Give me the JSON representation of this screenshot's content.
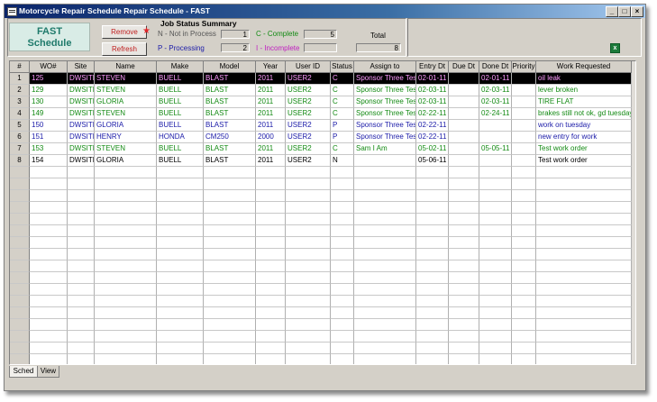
{
  "window": {
    "title": "Motorcycle Repair Schedule  Repair Schedule - FAST"
  },
  "app": {
    "title_line1": "FAST",
    "title_line2": "Schedule"
  },
  "toolbar": {
    "remove_label": "Remove",
    "refresh_label": "Refresh"
  },
  "summary": {
    "title": "Job Status Summary",
    "n_label": "N - Not in Process",
    "n_count": "1",
    "p_label": "P - Processing",
    "p_count": "2",
    "c_label": "C - Complete",
    "c_count": "5",
    "i_label": "I -  Incomplete",
    "i_count": "",
    "total_label": "Total",
    "total_count": "8"
  },
  "colors": {
    "complete": "#138a13",
    "processing": "#1a1aa8",
    "incomplete": "#c020c0",
    "header_bg": "#d4d0c8"
  },
  "grid": {
    "columns": [
      "#",
      "WO#",
      "Site",
      "Name",
      "Make",
      "Model",
      "Year",
      "User ID",
      "Status",
      "Assign to",
      "Entry Dt",
      "Due Dt",
      "Done Dt",
      "Priority",
      "Work Requested"
    ],
    "rows": [
      {
        "n": "1",
        "wo": "125",
        "site": "DWSITE",
        "name": "STEVEN",
        "make": "BUELL",
        "model": "BLAST",
        "year": "2011",
        "user": "USER2",
        "status": "C",
        "assign": "Sponsor Three Test",
        "entry": "02-01-11",
        "due": "",
        "done": "02-01-11",
        "priority": "",
        "work": "oil leak",
        "color": "#ff9bff",
        "selected": true
      },
      {
        "n": "2",
        "wo": "129",
        "site": "DWSITE",
        "name": "STEVEN",
        "make": "BUELL",
        "model": "BLAST",
        "year": "2011",
        "user": "USER2",
        "status": "C",
        "assign": "Sponsor Three Test",
        "entry": "02-03-11",
        "due": "",
        "done": "02-03-11",
        "priority": "",
        "work": "lever broken",
        "color": "#138a13",
        "selected": false
      },
      {
        "n": "3",
        "wo": "130",
        "site": "DWSITE",
        "name": "GLORIA",
        "make": "BUELL",
        "model": "BLAST",
        "year": "2011",
        "user": "USER2",
        "status": "C",
        "assign": "Sponsor Three Test",
        "entry": "02-03-11",
        "due": "",
        "done": "02-03-11",
        "priority": "",
        "work": "TIRE FLAT",
        "color": "#138a13",
        "selected": false
      },
      {
        "n": "4",
        "wo": "149",
        "site": "DWSITE",
        "name": "STEVEN",
        "make": "BUELL",
        "model": "BLAST",
        "year": "2011",
        "user": "USER2",
        "status": "C",
        "assign": "Sponsor Three Test",
        "entry": "02-22-11",
        "due": "",
        "done": "02-24-11",
        "priority": "",
        "work": "brakes still not ok, gd tuesday",
        "color": "#138a13",
        "selected": false
      },
      {
        "n": "5",
        "wo": "150",
        "site": "DWSITE",
        "name": "GLORIA",
        "make": "BUELL",
        "model": "BLAST",
        "year": "2011",
        "user": "USER2",
        "status": "P",
        "assign": "Sponsor Three Test",
        "entry": "02-22-11",
        "due": "",
        "done": "",
        "priority": "",
        "work": "work on tuesday",
        "color": "#1a1aa8",
        "selected": false
      },
      {
        "n": "6",
        "wo": "151",
        "site": "DWSITE",
        "name": "HENRY",
        "make": "HONDA",
        "model": "CM250",
        "year": "2000",
        "user": "USER2",
        "status": "P",
        "assign": "Sponsor Three Test",
        "entry": "02-22-11",
        "due": "",
        "done": "",
        "priority": "",
        "work": "new entry for work",
        "color": "#1a1aa8",
        "selected": false
      },
      {
        "n": "7",
        "wo": "153",
        "site": "DWSITE",
        "name": "STEVEN",
        "make": "BUELL",
        "model": "BLAST",
        "year": "2011",
        "user": "USER2",
        "status": "C",
        "assign": "Sam I Am",
        "entry": "05-02-11",
        "due": "",
        "done": "05-05-11",
        "priority": "",
        "work": "Test work order",
        "color": "#138a13",
        "selected": false
      },
      {
        "n": "8",
        "wo": "154",
        "site": "DWSITE",
        "name": "GLORIA",
        "make": "BUELL",
        "model": "BLAST",
        "year": "2011",
        "user": "USER2",
        "status": "N",
        "assign": "",
        "entry": "05-06-11",
        "due": "",
        "done": "",
        "priority": "",
        "work": "Test work order",
        "color": "#000000",
        "selected": false
      }
    ]
  },
  "tabs": [
    "Sched",
    "View"
  ]
}
